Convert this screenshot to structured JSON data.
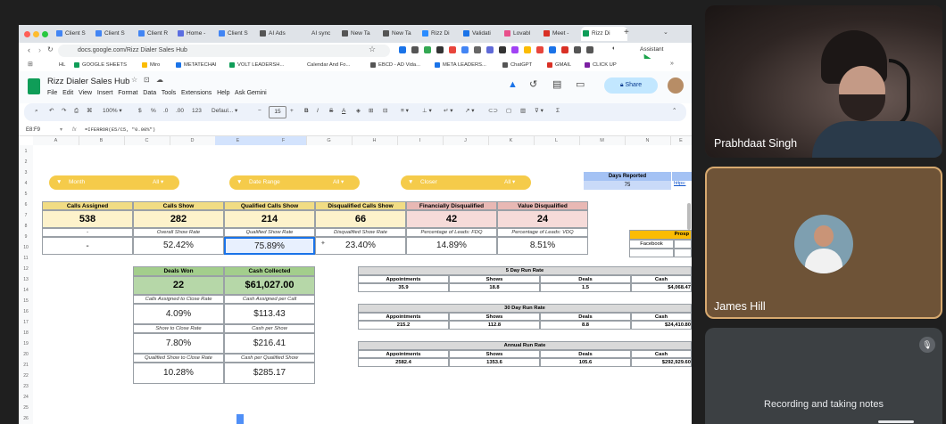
{
  "browser": {
    "tabs": [
      "Client S",
      "Client S",
      "Client R",
      "Home -",
      "Client S",
      "AI Ads",
      "AI sync",
      "New Ta",
      "New Ta",
      "Rizz Di",
      "Validati",
      "Lovabl",
      "Meet -",
      "Rizz Di"
    ],
    "url": "docs.google.com/Rizz Dialer Sales Hub",
    "assistant_label": "Assistant",
    "bookmarks": [
      "HL",
      "GOOGLE SHEETS",
      "Miro",
      "METATECHAI",
      "VOLT LEADERSH...",
      "Calendar And Fo...",
      "EBCD - AD Vida...",
      "META LEADERS...",
      "ChatGPT",
      "GMAIL",
      "CLICK UP"
    ]
  },
  "sheet": {
    "title": "Rizz Dialer Sales Hub",
    "menu": [
      "File",
      "Edit",
      "View",
      "Insert",
      "Format",
      "Data",
      "Tools",
      "Extensions",
      "Help",
      "Ask Gemini"
    ],
    "share_label": "Share",
    "toolbar": {
      "zoom": "100%",
      "currency": "$",
      "percent": "%",
      "dec_dec": ".0",
      "dec_inc": ".00",
      "fmt_123": "123",
      "font": "Defaul...",
      "font_size": "15",
      "bold": "B",
      "italic": "I",
      "strike": "S",
      "underline": "A",
      "sigma": "Σ"
    },
    "cell_ref": "E8:F9",
    "formula": "=IFERROR(E5/C5, \"0.00%\")",
    "columns": [
      "A",
      "B",
      "C",
      "D",
      "E",
      "F",
      "G",
      "H",
      "I",
      "J",
      "K",
      "L",
      "M",
      "N",
      "E"
    ],
    "rows": [
      "1",
      "2",
      "3",
      "4",
      "5",
      "6",
      "7",
      "8",
      "9",
      "10",
      "11",
      "12",
      "13",
      "14",
      "15",
      "16",
      "17",
      "18",
      "19",
      "20",
      "21",
      "22",
      "23",
      "24",
      "25",
      "26"
    ],
    "filters": [
      {
        "label": "Month",
        "value": "All"
      },
      {
        "label": "Date Range",
        "value": "All"
      },
      {
        "label": "Closer",
        "value": "All"
      }
    ],
    "days_reported": {
      "label": "Days Reported",
      "value": "75",
      "link": "https:"
    },
    "kpis": [
      {
        "label": "Calls Assigned",
        "value": "538",
        "sub": "-",
        "pct": "-"
      },
      {
        "label": "Calls Show",
        "value": "282",
        "sub": "Overall Show Rate",
        "pct": "52.42%"
      },
      {
        "label": "Qualified Calls Show",
        "value": "214",
        "sub": "Qualified Show Rate",
        "pct": "75.89%"
      },
      {
        "label": "Disqualified Calls Show",
        "value": "66",
        "sub": "Disqualified Show Rate",
        "pct": "23.40%"
      },
      {
        "label": "Financially Disqualified",
        "value": "42",
        "sub": "Percentage of Leads: FDQ",
        "pct": "14.89%"
      },
      {
        "label": "Value Disqualified",
        "value": "24",
        "sub": "Percentage of Leads: VDQ",
        "pct": "8.51%"
      }
    ],
    "prospect": {
      "label": "Prosp",
      "source": "Facebook"
    },
    "deals": {
      "won_label": "Deals Won",
      "won_value": "22",
      "cash_label": "Cash Collected",
      "cash_value": "$61,027.00",
      "metrics": [
        {
          "left_label": "Calls Assigned to Close Rate",
          "left_value": "4.09%",
          "right_label": "Cash Assigned per Call",
          "right_value": "$113.43"
        },
        {
          "left_label": "Show to Close Rate",
          "left_value": "7.80%",
          "right_label": "Cash per Show",
          "right_value": "$216.41"
        },
        {
          "left_label": "Qualified Show to Close Rate",
          "left_value": "10.28%",
          "right_label": "Cash per Qualified Show",
          "right_value": "$285.17"
        }
      ]
    },
    "run_rates": [
      {
        "title": "5 Day Run Rate",
        "headers": [
          "Appointments",
          "Shows",
          "Deals",
          "Cash"
        ],
        "values": [
          "35.9",
          "18.8",
          "1.5",
          "$4,068.47"
        ]
      },
      {
        "title": "30 Day Run Rate",
        "headers": [
          "Appointments",
          "Shows",
          "Deals",
          "Cash"
        ],
        "values": [
          "215.2",
          "112.8",
          "8.8",
          "$24,410.80"
        ]
      },
      {
        "title": "Annual Run Rate",
        "headers": [
          "Appointments",
          "Shows",
          "Deals",
          "Cash"
        ],
        "values": [
          "2582.4",
          "1353.6",
          "105.6",
          "$292,929.60"
        ]
      }
    ]
  },
  "participants": [
    {
      "name": "Prabhdaat Singh"
    },
    {
      "name": "James Hill"
    },
    {
      "name": "",
      "status": "Recording and taking notes"
    }
  ]
}
